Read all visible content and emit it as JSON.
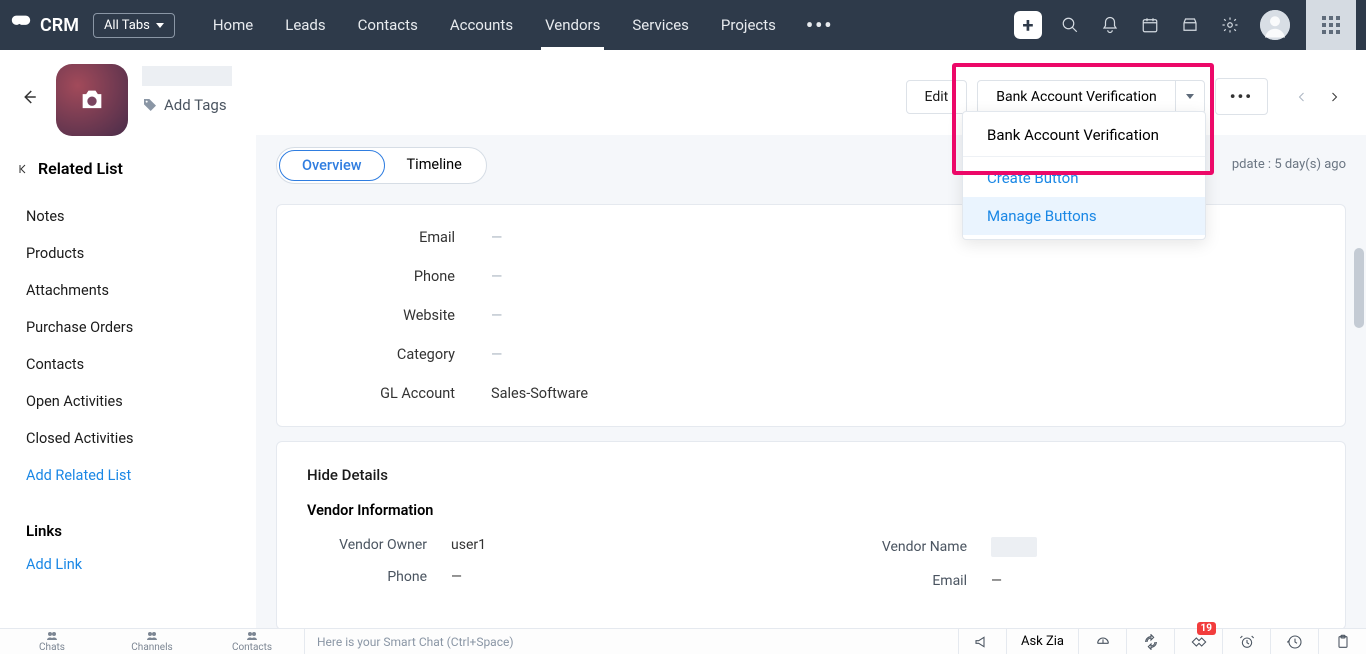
{
  "topnav": {
    "logo_text": "CRM",
    "all_tabs": "All Tabs",
    "links": [
      "Home",
      "Leads",
      "Contacts",
      "Accounts",
      "Vendors",
      "Services",
      "Projects"
    ],
    "active_index": 4
  },
  "record_header": {
    "add_tags": "Add Tags",
    "edit": "Edit",
    "primary_button": "Bank Account Verification"
  },
  "dropdown": {
    "item1": "Bank Account Verification",
    "create": "Create Button",
    "manage": "Manage Buttons"
  },
  "sidebar": {
    "title": "Related List",
    "items": [
      "Notes",
      "Products",
      "Attachments",
      "Purchase Orders",
      "Contacts",
      "Open Activities",
      "Closed Activities"
    ],
    "add_related": "Add Related List",
    "links_title": "Links",
    "add_link": "Add Link"
  },
  "main": {
    "tab_overview": "Overview",
    "tab_timeline": "Timeline",
    "last_update_prefix": "pdate : ",
    "last_update_value": "5 day(s) ago",
    "fields": {
      "email_label": "Email",
      "email_value": "—",
      "phone_label": "Phone",
      "phone_value": "—",
      "website_label": "Website",
      "website_value": "—",
      "category_label": "Category",
      "category_value": "—",
      "gl_label": "GL Account",
      "gl_value": "Sales-Software"
    },
    "hide_details": "Hide Details",
    "vendor_info": "Vendor Information",
    "vendor_owner_label": "Vendor Owner",
    "vendor_owner_value": "user1",
    "phone2_label": "Phone",
    "phone2_value": "—",
    "vendor_name_label": "Vendor Name",
    "email2_label": "Email",
    "email2_value": "—"
  },
  "bottombar": {
    "tabs": [
      "Chats",
      "Channels",
      "Contacts"
    ],
    "smart_chat": "Here is your Smart Chat (Ctrl+Space)",
    "ask_zia": "Ask Zia",
    "badge": "19"
  }
}
